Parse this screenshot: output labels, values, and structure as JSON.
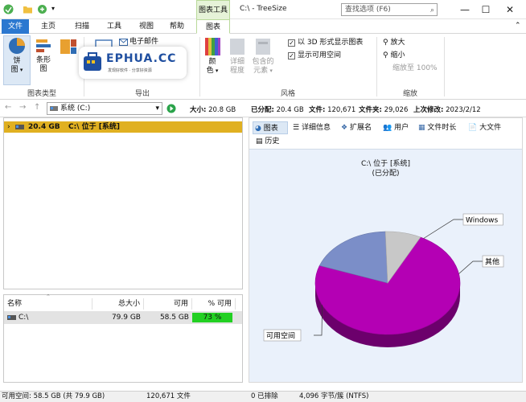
{
  "window": {
    "title": "C:\\ - TreeSize",
    "context_group": "图表工具",
    "search_placeholder": "查找选项 (F6)",
    "controls": [
      "—",
      "☐",
      "✕"
    ]
  },
  "tabs": [
    {
      "label": "文件"
    },
    {
      "label": "主页"
    },
    {
      "label": "扫描"
    },
    {
      "label": "工具"
    },
    {
      "label": "视图"
    },
    {
      "label": "帮助"
    },
    {
      "label": "图表"
    }
  ],
  "ribbon": {
    "chart_type": {
      "pie_label": "饼\n图",
      "bar_label": "条形\n图",
      "group_label": "图表类型"
    },
    "export": {
      "email_label": "电子邮件",
      "group_label": "导出"
    },
    "style": {
      "color_label": "颜\n色",
      "detail_label": "详细\n程度",
      "include_label": "包含的\n元素",
      "chk_3d": "以 3D 形式显示图表",
      "chk_free": "显示可用空间",
      "group_label": "风格"
    },
    "zoom": {
      "zoom_in": "放大",
      "zoom_out": "缩小",
      "zoom_100": "缩放至 100%",
      "group_label": "缩放"
    }
  },
  "logo": {
    "text": "EPHUA.CC",
    "sub": "发现好软件 · 分享好资源"
  },
  "address": {
    "drive": "系统 (C:)",
    "stats": [
      {
        "label": "大小:",
        "value": "20.8 GB"
      },
      {
        "label": "已分配:",
        "value": "20.4 GB"
      },
      {
        "label": "文件:",
        "value": "120,671"
      },
      {
        "label": "文件夹:",
        "value": "29,026"
      },
      {
        "label": "上次修改:",
        "value": "2023/2/12"
      }
    ]
  },
  "tree": {
    "size": "20.4 GB",
    "path": "C:\\  位于 [系统]"
  },
  "list": {
    "headers": [
      "名称",
      "总大小",
      "可用",
      "% 可用"
    ],
    "row": {
      "name": "C:\\",
      "total": "79.9 GB",
      "free": "58.5 GB",
      "pct": "73 %",
      "pct_value": 73
    }
  },
  "right_tabs": [
    "图表",
    "详细信息",
    "扩展名",
    "用户",
    "文件时长",
    "大文件",
    "历史"
  ],
  "chart_data": {
    "type": "pie",
    "title": "C:\\  位于 [系统]",
    "subtitle": "(已分配)",
    "slices": [
      {
        "label": "可用空间",
        "value": 73,
        "color": "#b400b4"
      },
      {
        "label": "Windows",
        "value": 19,
        "color": "#7b8ec8"
      },
      {
        "label": "其他",
        "value": 8,
        "color": "#c8c8c8"
      }
    ],
    "three_d": true
  },
  "status": {
    "free": "可用空间: 58.5 GB (共 79.9 GB)",
    "files": "120,671 文件",
    "excluded": "0 已排除",
    "cluster": "4,096 字节/簇 (NTFS)"
  }
}
